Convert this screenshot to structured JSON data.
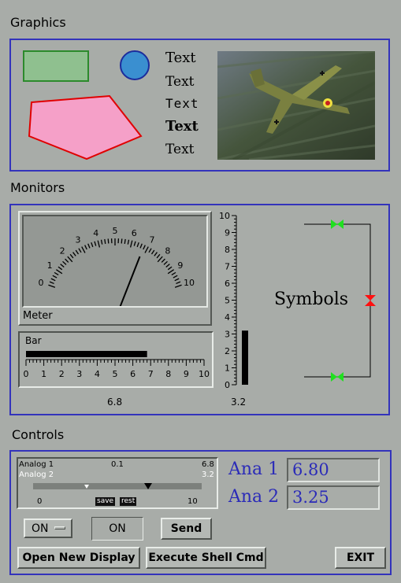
{
  "sections": {
    "graphics": "Graphics",
    "monitors": "Monitors",
    "controls": "Controls"
  },
  "graphics": {
    "texts": [
      "Text",
      "Text",
      "Text",
      "Text",
      "Text"
    ],
    "colors": {
      "rect_fill": "#8fc08f",
      "rect_stroke": "#2c8a2c",
      "circle_fill": "#3a8fd0",
      "polygon_fill": "#f5a0c8",
      "polygon_stroke": "#e00000"
    },
    "image_icon": "airplane-photo"
  },
  "monitors": {
    "meter": {
      "label": "Meter",
      "ticks": [
        "0",
        "1",
        "2",
        "3",
        "4",
        "5",
        "6",
        "7",
        "8",
        "9",
        "10"
      ],
      "value": 6.8,
      "min": 0,
      "max": 10
    },
    "bar": {
      "label": "Bar",
      "ticks": [
        "0",
        "1",
        "2",
        "3",
        "4",
        "5",
        "6",
        "7",
        "8",
        "9",
        "10"
      ],
      "value": 6.8,
      "value_text": "6.8"
    },
    "vbar": {
      "ticks": [
        "0",
        "1",
        "2",
        "3",
        "4",
        "5",
        "6",
        "7",
        "8",
        "9",
        "10"
      ],
      "value": 3.2,
      "value_text": "3.2"
    },
    "symbols_label": "Symbols",
    "colors": {
      "valve_open": "#20e020",
      "valve_closed": "#ff1010"
    }
  },
  "controls": {
    "slider": {
      "analog1_label": "Analog 1",
      "analog1_value": "0.1",
      "analog1_max": "6.8",
      "analog2_label": "Analog 2",
      "analog2_max": "3.2",
      "scale_min": "0",
      "scale_max": "10",
      "save_label": "save",
      "rest_label": "rest",
      "analog1_setpoint": 6.8,
      "analog2_setpoint": 3.2
    },
    "ana1": {
      "label": "Ana 1",
      "value": "6.80"
    },
    "ana2": {
      "label": "Ana 2",
      "value": "3.25"
    },
    "option_menu_value": "ON",
    "indicator_text": "ON",
    "send_label": "Send",
    "open_display_label": "Open New Display",
    "shell_cmd_label": "Execute Shell Cmd",
    "exit_label": "EXIT"
  }
}
